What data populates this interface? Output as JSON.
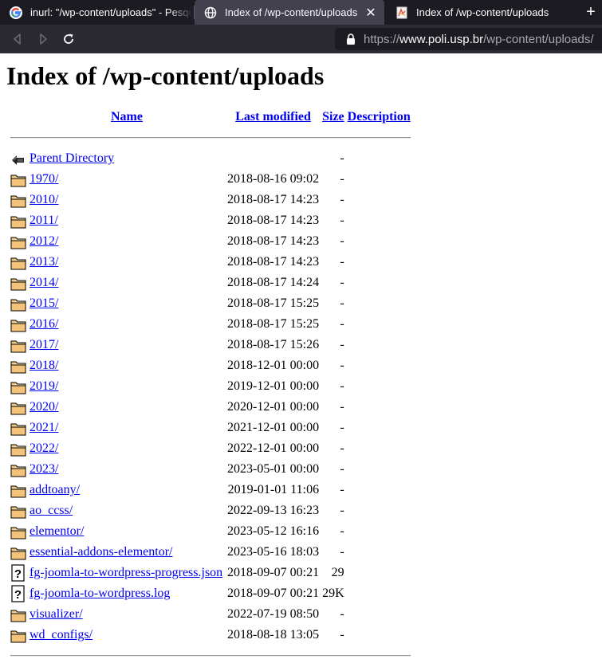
{
  "browser": {
    "tabs": [
      {
        "title": "inurl: \"/wp-content/uploads\" - Pesquisa Google",
        "icon": "google-icon",
        "active": false
      },
      {
        "title": "Index of /wp-content/uploads",
        "icon": "globe-icon",
        "active": true,
        "close": "✕"
      },
      {
        "title": "Index of /wp-content/uploads",
        "icon": "pdf-page-icon",
        "active": false
      }
    ],
    "new_tab": "+",
    "url": {
      "scheme": "https://",
      "host": "www.poli.usp.br",
      "path": "/wp-content/uploads/"
    },
    "colors": {
      "tabbar": "#1c1b22",
      "active_tab": "#42414d",
      "toolbar": "#2b2a33",
      "urlbar": "#1c1b22"
    }
  },
  "page": {
    "title": "Index of /wp-content/uploads",
    "columns": {
      "name": "Name",
      "modified": "Last modified",
      "size": "Size",
      "description": "Description"
    },
    "rows": [
      {
        "name": "Parent Directory",
        "modified": "",
        "size": "-",
        "icon": "back-icon"
      },
      {
        "name": "1970/",
        "modified": "2018-08-16 09:02",
        "size": "-",
        "icon": "folder-icon"
      },
      {
        "name": "2010/",
        "modified": "2018-08-17 14:23",
        "size": "-",
        "icon": "folder-icon"
      },
      {
        "name": "2011/",
        "modified": "2018-08-17 14:23",
        "size": "-",
        "icon": "folder-icon"
      },
      {
        "name": "2012/",
        "modified": "2018-08-17 14:23",
        "size": "-",
        "icon": "folder-icon"
      },
      {
        "name": "2013/",
        "modified": "2018-08-17 14:23",
        "size": "-",
        "icon": "folder-icon"
      },
      {
        "name": "2014/",
        "modified": "2018-08-17 14:24",
        "size": "-",
        "icon": "folder-icon"
      },
      {
        "name": "2015/",
        "modified": "2018-08-17 15:25",
        "size": "-",
        "icon": "folder-icon"
      },
      {
        "name": "2016/",
        "modified": "2018-08-17 15:25",
        "size": "-",
        "icon": "folder-icon"
      },
      {
        "name": "2017/",
        "modified": "2018-08-17 15:26",
        "size": "-",
        "icon": "folder-icon"
      },
      {
        "name": "2018/",
        "modified": "2018-12-01 00:00",
        "size": "-",
        "icon": "folder-icon"
      },
      {
        "name": "2019/",
        "modified": "2019-12-01 00:00",
        "size": "-",
        "icon": "folder-icon"
      },
      {
        "name": "2020/",
        "modified": "2020-12-01 00:00",
        "size": "-",
        "icon": "folder-icon"
      },
      {
        "name": "2021/",
        "modified": "2021-12-01 00:00",
        "size": "-",
        "icon": "folder-icon"
      },
      {
        "name": "2022/",
        "modified": "2022-12-01 00:00",
        "size": "-",
        "icon": "folder-icon"
      },
      {
        "name": "2023/",
        "modified": "2023-05-01 00:00",
        "size": "-",
        "icon": "folder-icon"
      },
      {
        "name": "addtoany/",
        "modified": "2019-01-01 11:06",
        "size": "-",
        "icon": "folder-icon"
      },
      {
        "name": "ao_ccss/",
        "modified": "2022-09-13 16:23",
        "size": "-",
        "icon": "folder-icon"
      },
      {
        "name": "elementor/",
        "modified": "2023-05-12 16:16",
        "size": "-",
        "icon": "folder-icon"
      },
      {
        "name": "essential-addons-elementor/",
        "modified": "2023-05-16 18:03",
        "size": "-",
        "icon": "folder-icon"
      },
      {
        "name": "fg-joomla-to-wordpress-progress.json",
        "modified": "2018-09-07 00:21",
        "size": "29",
        "icon": "unknown-file-icon"
      },
      {
        "name": "fg-joomla-to-wordpress.log",
        "modified": "2018-09-07 00:21",
        "size": "29K",
        "icon": "unknown-file-icon"
      },
      {
        "name": "visualizer/",
        "modified": "2022-07-19 08:50",
        "size": "-",
        "icon": "folder-icon"
      },
      {
        "name": "wd_configs/",
        "modified": "2018-08-18 13:05",
        "size": "-",
        "icon": "folder-icon"
      }
    ]
  }
}
